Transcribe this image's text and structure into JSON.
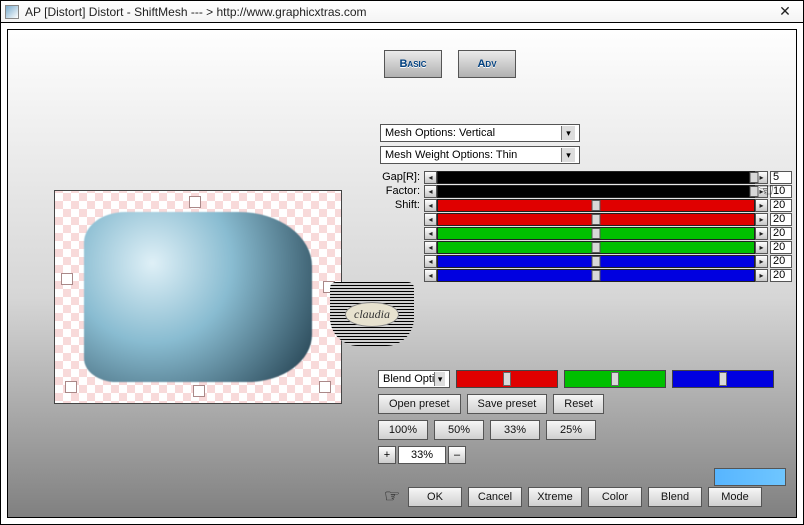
{
  "window": {
    "title": "AP [Distort]  Distort - ShiftMesh    --- >  http://www.graphicxtras.com"
  },
  "mode_tabs": {
    "basic": "Basic",
    "adv": "Adv"
  },
  "dropdowns": {
    "mesh_options": "Mesh Options: Vertical",
    "mesh_weight": "Mesh Weight Options: Thin",
    "blend": "Blend Options"
  },
  "slider_labels": {
    "gap": "Gap[R]:",
    "factor": "Factor:",
    "shift": "Shift:"
  },
  "sliders": {
    "gap": {
      "value": "5",
      "color": "black",
      "pos": 100
    },
    "factor": {
      "value": "10",
      "color": "black",
      "pos": 100
    },
    "shift": {
      "value": "20",
      "color": "red",
      "pos": 50
    },
    "r2": {
      "value": "20",
      "color": "red",
      "pos": 50
    },
    "g1": {
      "value": "20",
      "color": "green",
      "pos": 50
    },
    "g2": {
      "value": "20",
      "color": "green",
      "pos": 50
    },
    "b1": {
      "value": "20",
      "color": "blue",
      "pos": 50
    },
    "b2": {
      "value": "20",
      "color": "blue",
      "pos": 50
    }
  },
  "mid_buttons": {
    "open_preset": "Open preset",
    "save_preset": "Save preset",
    "reset": "Reset"
  },
  "pct": {
    "p100": "100%",
    "p50": "50%",
    "p33": "33%",
    "p25": "25%"
  },
  "zoom": {
    "plus": "+",
    "value": "33%",
    "minus": "–"
  },
  "bottom": {
    "ok": "OK",
    "cancel": "Cancel",
    "xtreme": "Xtreme",
    "color": "Color",
    "blend": "Blend",
    "mode": "Mode"
  },
  "watermark": "claudia",
  "colors": {
    "red": "#e00000",
    "green": "#00c000",
    "blue": "#0000e0",
    "swatch": "#57b5ff"
  }
}
